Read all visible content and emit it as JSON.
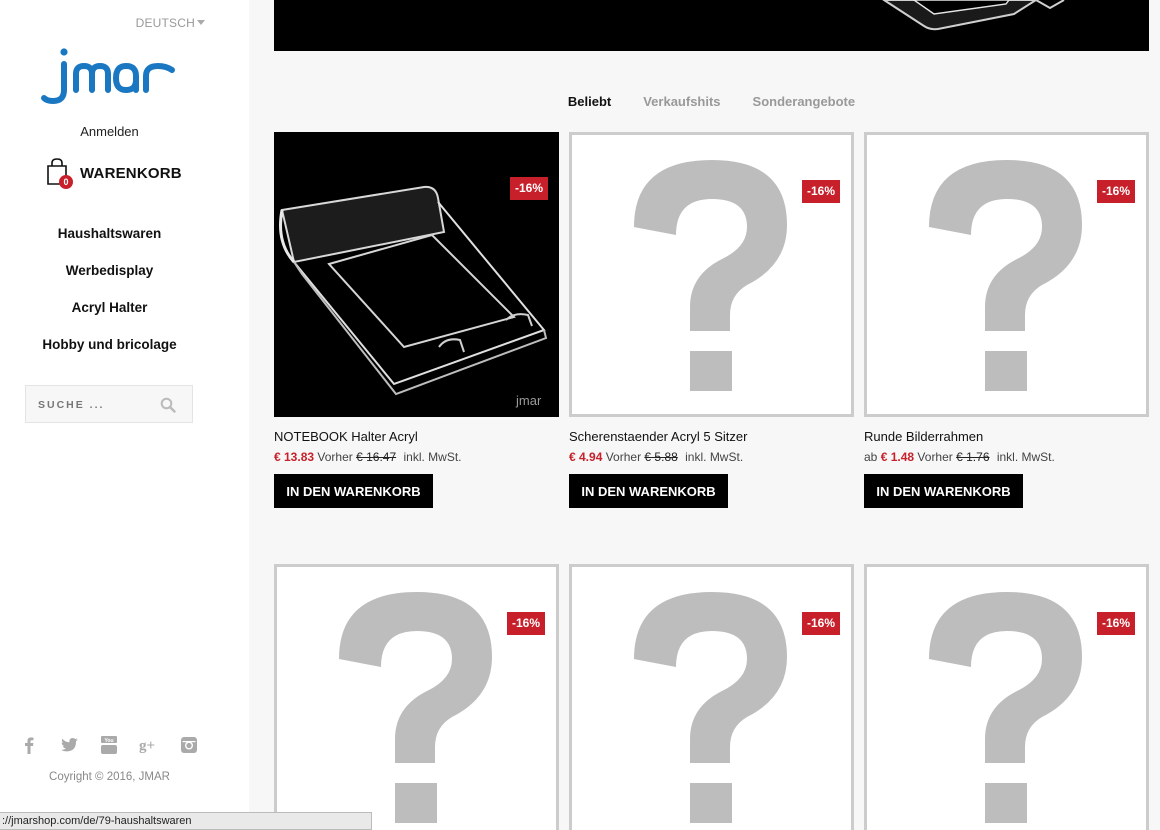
{
  "sidebar": {
    "language": "DEUTSCH",
    "login": "Anmelden",
    "cart_label": "WARENKORB",
    "cart_count": "0",
    "nav": [
      "Haushaltswaren",
      "Werbedisplay",
      "Acryl Halter",
      "Hobby und bricolage"
    ],
    "search_placeholder": "SUCHE ...",
    "socials": [
      "facebook-icon",
      "twitter-icon",
      "youtube-icon",
      "googleplus-icon",
      "instagram-icon"
    ],
    "copyright": "Coyright © 2016, JMAR"
  },
  "tabs": [
    "Beliebt",
    "Verkaufshits",
    "Sonderangebote"
  ],
  "products": [
    {
      "name": "NOTEBOOK Halter Acryl",
      "prefix": "",
      "price": "€ 13.83",
      "before": "Vorher",
      "old_price": "€ 16.47",
      "tax": "inkl. MwSt.",
      "discount": "-16%",
      "button": "IN DEN WARENKORB",
      "image_text": "jmar"
    },
    {
      "name": "Scherenstaender Acryl 5 Sitzer",
      "prefix": "",
      "price": "€ 4.94",
      "before": "Vorher",
      "old_price": "€ 5.88",
      "tax": "inkl. MwSt.",
      "discount": "-16%",
      "button": "IN DEN WARENKORB"
    },
    {
      "name": "Runde Bilderrahmen",
      "prefix": "ab",
      "price": "€ 1.48",
      "before": "Vorher",
      "old_price": "€ 1.76",
      "tax": "inkl. MwSt.",
      "discount": "-16%",
      "button": "IN DEN WARENKORB"
    },
    {
      "discount": "-16%"
    },
    {
      "discount": "-16%"
    },
    {
      "discount": "-16%"
    }
  ],
  "status_url": "://jmarshop.com/de/79-haushaltswaren",
  "colors": {
    "accent": "#c8202a",
    "logo": "#1a78c2"
  }
}
